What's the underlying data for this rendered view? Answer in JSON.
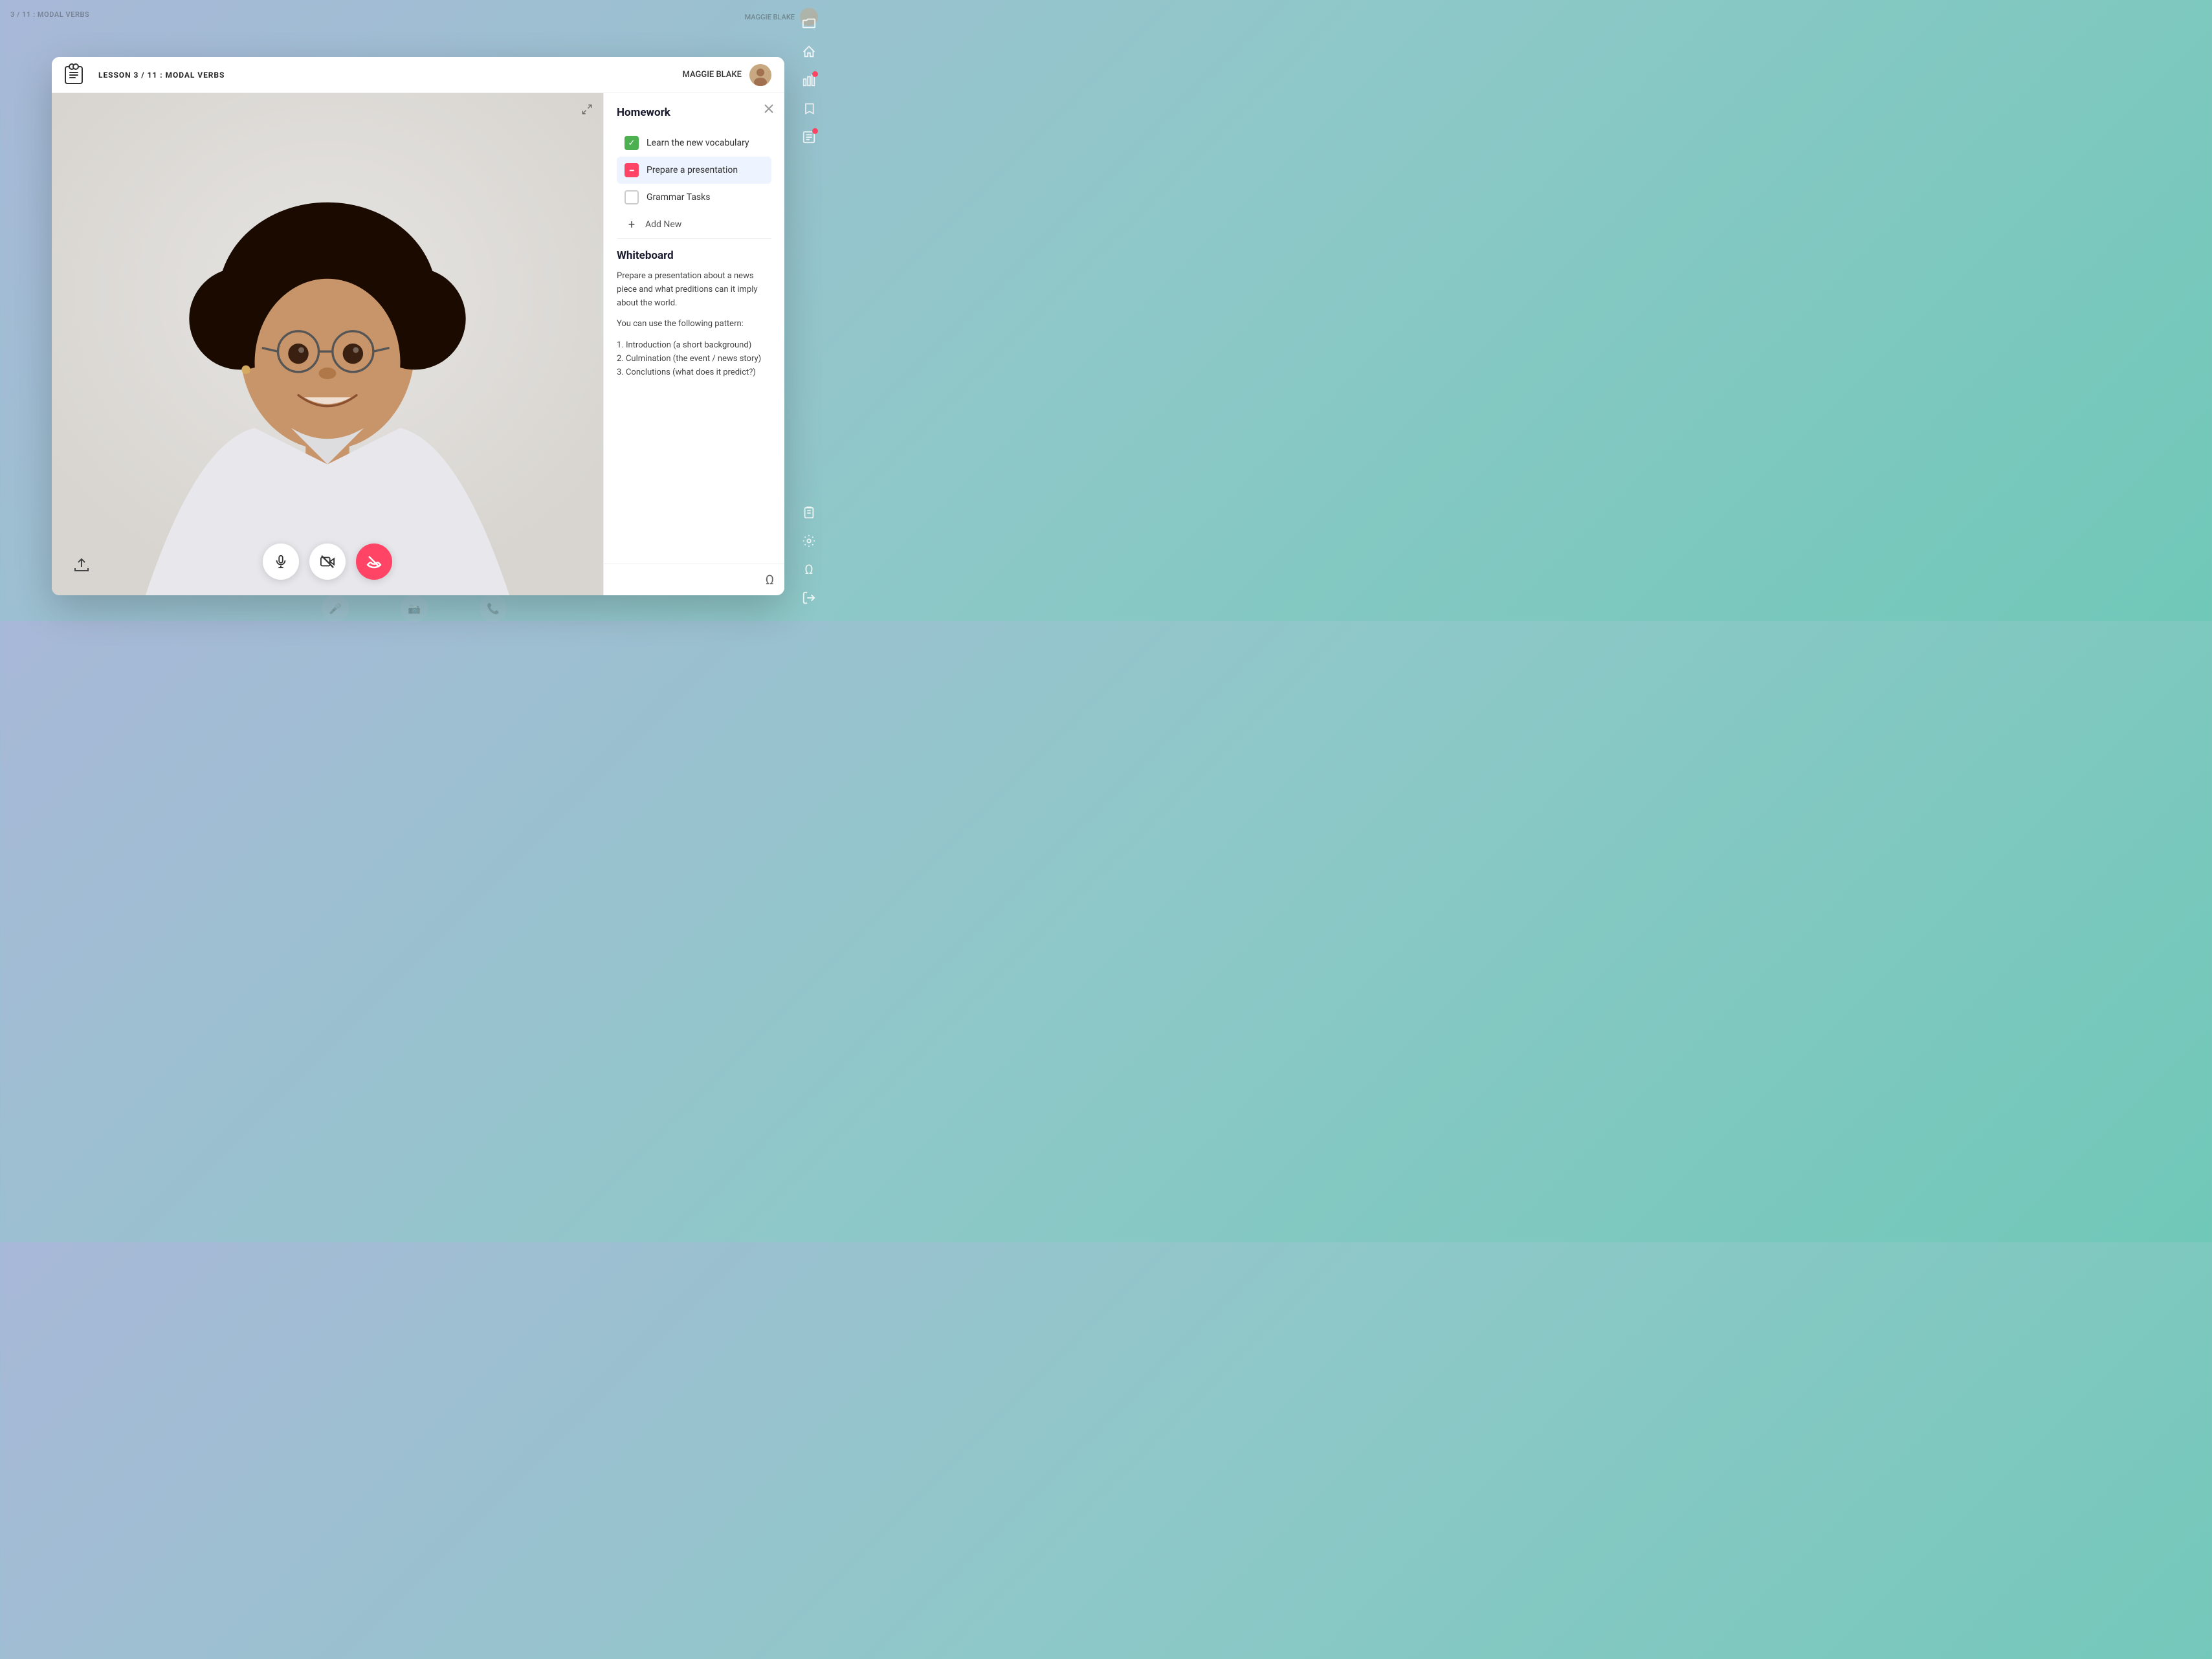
{
  "app": {
    "bg_title": "3 / 11 : MODAL VERBS",
    "bg_user": "MAGGIE BLAKE"
  },
  "window": {
    "lesson_label": "LESSON 3 / 11 : MODAL VERBS",
    "user_name": "MAGGIE BLAKE"
  },
  "homework": {
    "title": "Homework",
    "items": [
      {
        "id": "hw1",
        "label": "Learn the new vocabulary",
        "state": "checked"
      },
      {
        "id": "hw2",
        "label": "Prepare a presentation",
        "state": "minus",
        "active": true
      },
      {
        "id": "hw3",
        "label": "Grammar Tasks",
        "state": "empty"
      }
    ],
    "add_new_label": "Add New"
  },
  "whiteboard": {
    "title": "Whiteboard",
    "paragraphs": [
      "Prepare a presentation about a news piece and what preditions can it imply about the world.",
      "You can use the following pattern:",
      "1. Introduction (a short background)\n2. Culmination (the event / news story)\n3. Conclutions (what does it predict?)"
    ]
  },
  "controls": {
    "mic_label": "Microphone",
    "video_label": "Video off",
    "hangup_label": "Hang up"
  },
  "right_sidebar": {
    "icons": [
      {
        "name": "folder-icon",
        "symbol": "📁",
        "active": false
      },
      {
        "name": "home-icon",
        "symbol": "⌂",
        "active": false
      },
      {
        "name": "chart-icon",
        "symbol": "📊",
        "active": false,
        "badge": true
      },
      {
        "name": "bookmark-icon",
        "symbol": "🔖",
        "active": false
      },
      {
        "name": "notes-icon",
        "symbol": "📝",
        "active": false,
        "badge": true
      },
      {
        "name": "clipboard-icon",
        "symbol": "📋",
        "active": false
      },
      {
        "name": "settings-icon",
        "symbol": "⚙",
        "active": false
      },
      {
        "name": "list-icon",
        "symbol": "☰",
        "active": false
      },
      {
        "name": "signout-icon",
        "symbol": "→",
        "active": false
      }
    ]
  }
}
